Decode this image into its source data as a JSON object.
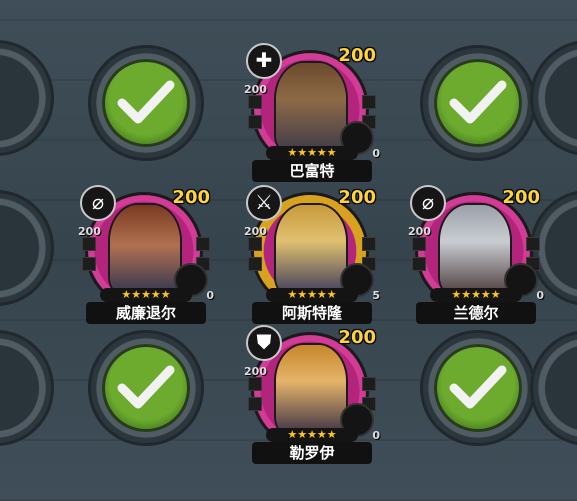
{
  "colors": {
    "portrait_ring": "#b3247c",
    "level": "#ffd43a",
    "check_green": "#6dab2f",
    "star": "#ffc61a"
  },
  "grid_slots": [
    {
      "id": "r1-left",
      "state": "empty"
    },
    {
      "id": "r1-c2",
      "state": "checked",
      "icon": "checkmark-icon"
    },
    {
      "id": "r1-c4",
      "state": "checked",
      "icon": "checkmark-icon"
    },
    {
      "id": "r1-right",
      "state": "empty"
    },
    {
      "id": "r2-left",
      "state": "empty"
    },
    {
      "id": "r2-right",
      "state": "empty"
    },
    {
      "id": "r3-left",
      "state": "empty"
    },
    {
      "id": "r3-c2",
      "state": "checked",
      "icon": "checkmark-icon"
    },
    {
      "id": "r3-c4",
      "state": "checked",
      "icon": "checkmark-icon"
    },
    {
      "id": "r3-right",
      "state": "empty"
    }
  ],
  "heroes": [
    {
      "name": "巴富特",
      "level": "200",
      "sub_level": "200",
      "class_icon": "cross-icon",
      "class_glyph": "✚",
      "stars": "★★★★★",
      "cooldown": "0",
      "frame": "normal"
    },
    {
      "name": "威廉退尔",
      "level": "200",
      "sub_level": "200",
      "class_icon": "bow-icon",
      "class_glyph": "⌀",
      "stars": "★★★★★",
      "cooldown": "0",
      "frame": "normal"
    },
    {
      "name": "阿斯特隆",
      "level": "200",
      "sub_level": "200",
      "class_icon": "sword-icon",
      "class_glyph": "⚔",
      "stars": "★★★★★",
      "cooldown": "5",
      "frame": "gold"
    },
    {
      "name": "兰德尔",
      "level": "200",
      "sub_level": "200",
      "class_icon": "bow-icon",
      "class_glyph": "⌀",
      "stars": "★★★★★",
      "cooldown": "0",
      "frame": "normal"
    },
    {
      "name": "勒罗伊",
      "level": "200",
      "sub_level": "200",
      "class_icon": "shield-icon",
      "class_glyph": "⛊",
      "stars": "★★★★★",
      "cooldown": "0",
      "frame": "normal"
    }
  ]
}
